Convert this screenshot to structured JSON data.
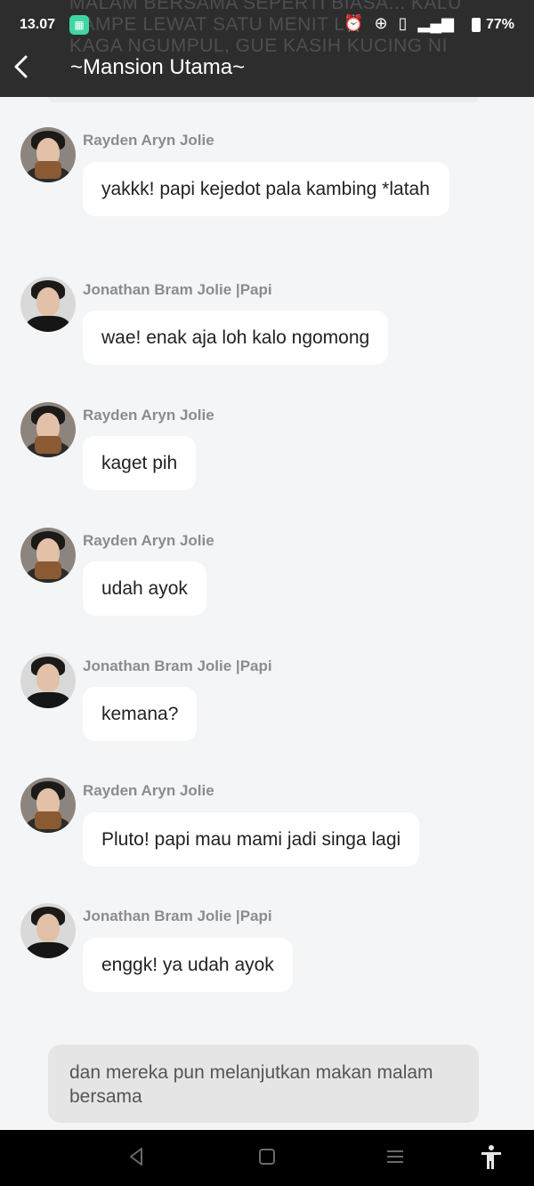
{
  "status_bar": {
    "time": "13.07",
    "battery": "77%"
  },
  "header": {
    "title": "~Mansion Utama~",
    "ghost_text": "MALAM BERSAMA SEPERTI BIASA... KALU\nSAMPE LEWAT SATU MENIT LU\nKAGA NGUMPUL, GUE KASIH KUCING NI"
  },
  "messages": [
    {
      "sender": "Rayden Aryn Jolie",
      "text": "yakkk! papi kejedot pala kambing *latah"
    },
    {
      "sender": "Jonathan Bram Jolie |Papi",
      "text": "wae! enak aja loh kalo ngomong"
    },
    {
      "sender": "Rayden Aryn Jolie",
      "text": "kaget pih"
    },
    {
      "sender": "Rayden Aryn Jolie",
      "text": "udah ayok"
    },
    {
      "sender": "Jonathan Bram Jolie |Papi",
      "text": "kemana?"
    },
    {
      "sender": "Rayden Aryn Jolie",
      "text": "Pluto! papi mau mami jadi singa lagi"
    },
    {
      "sender": "Jonathan Bram Jolie |Papi",
      "text": "enggk! ya udah ayok"
    }
  ],
  "narration": "dan mereka pun melanjutkan makan malam bersama"
}
